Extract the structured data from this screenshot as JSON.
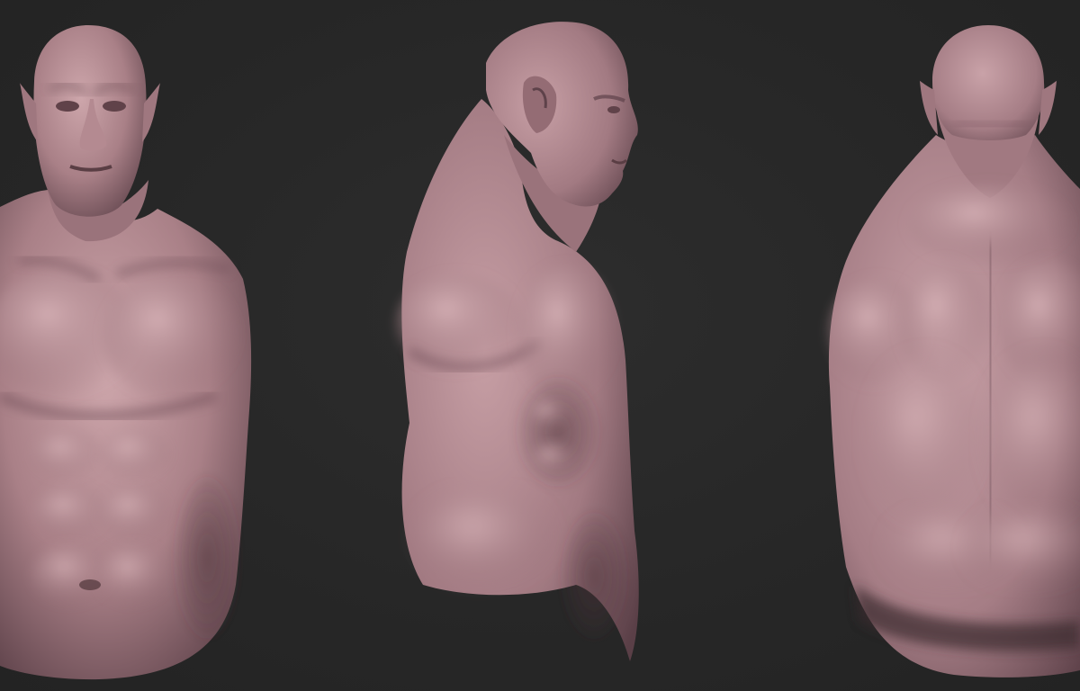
{
  "scene": {
    "background_color": "#282828",
    "material_base": "#b38a90",
    "material_highlight": "#d8b0b5",
    "material_shadow": "#5a3e44",
    "subject": "sculpted-humanoid-bust",
    "views": [
      {
        "id": "front",
        "icon": "front-view"
      },
      {
        "id": "side",
        "icon": "side-view"
      },
      {
        "id": "back",
        "icon": "back-view"
      }
    ]
  }
}
